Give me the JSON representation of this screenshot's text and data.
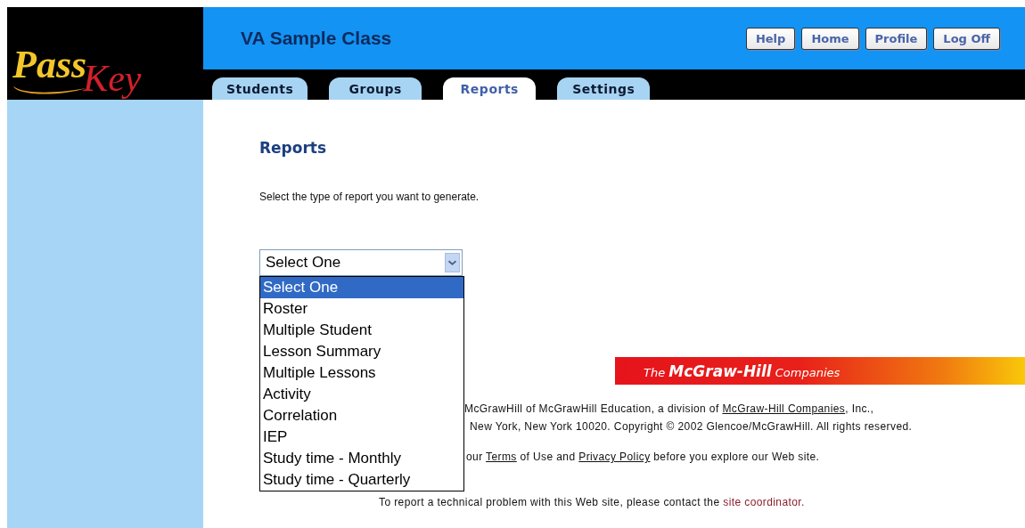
{
  "logo": {
    "first": "Pass",
    "second": "Key"
  },
  "class_title": "VA Sample Class",
  "header_buttons": [
    "Help",
    "Home",
    "Profile",
    "Log Off"
  ],
  "tabs": [
    {
      "label": "Students",
      "selected": false
    },
    {
      "label": "Groups",
      "selected": false
    },
    {
      "label": "Reports",
      "selected": true
    },
    {
      "label": "Settings",
      "selected": false
    }
  ],
  "heading": "Reports",
  "instruction": "Select the type of report you want to generate.",
  "report_select": {
    "value": "Select One",
    "expanded": true,
    "options": [
      {
        "label": "Select One",
        "selected": true
      },
      {
        "label": "Roster",
        "selected": false
      },
      {
        "label": "Multiple Student",
        "selected": false
      },
      {
        "label": "Lesson Summary",
        "selected": false
      },
      {
        "label": "Multiple Lessons",
        "selected": false
      },
      {
        "label": "Activity",
        "selected": false
      },
      {
        "label": "Correlation",
        "selected": false
      },
      {
        "label": "IEP",
        "selected": false
      },
      {
        "label": "Study time - Monthly",
        "selected": false
      },
      {
        "label": "Study time - Quarterly",
        "selected": false
      }
    ]
  },
  "banner": {
    "the": "The",
    "name": "McGraw-Hill",
    "companies": "Companies"
  },
  "footer": [
    {
      "parts": [
        {
          "kind": "text",
          "text": "McGrawHill of McGrawHill Education, a division of "
        },
        {
          "kind": "link",
          "text": "McGraw-Hill Companies"
        },
        {
          "kind": "text",
          "text": ", Inc.,"
        }
      ]
    },
    {
      "parts": [
        {
          "kind": "text",
          "text": "New York, New York 10020. Copyright © 2002 Glencoe/McGrawHill. All rights reserved."
        }
      ]
    },
    {
      "parts": [
        {
          "kind": "text",
          "text": "our "
        },
        {
          "kind": "link",
          "text": "Terms"
        },
        {
          "kind": "text",
          "text": " of Use and "
        },
        {
          "kind": "link",
          "text": "Privacy Policy"
        },
        {
          "kind": "text",
          "text": " before you explore our Web site."
        }
      ]
    },
    {
      "parts": [
        {
          "kind": "text",
          "text": "To report a technical problem with this Web site, please contact the "
        },
        {
          "kind": "contact",
          "text": "site coordinator."
        }
      ]
    }
  ]
}
